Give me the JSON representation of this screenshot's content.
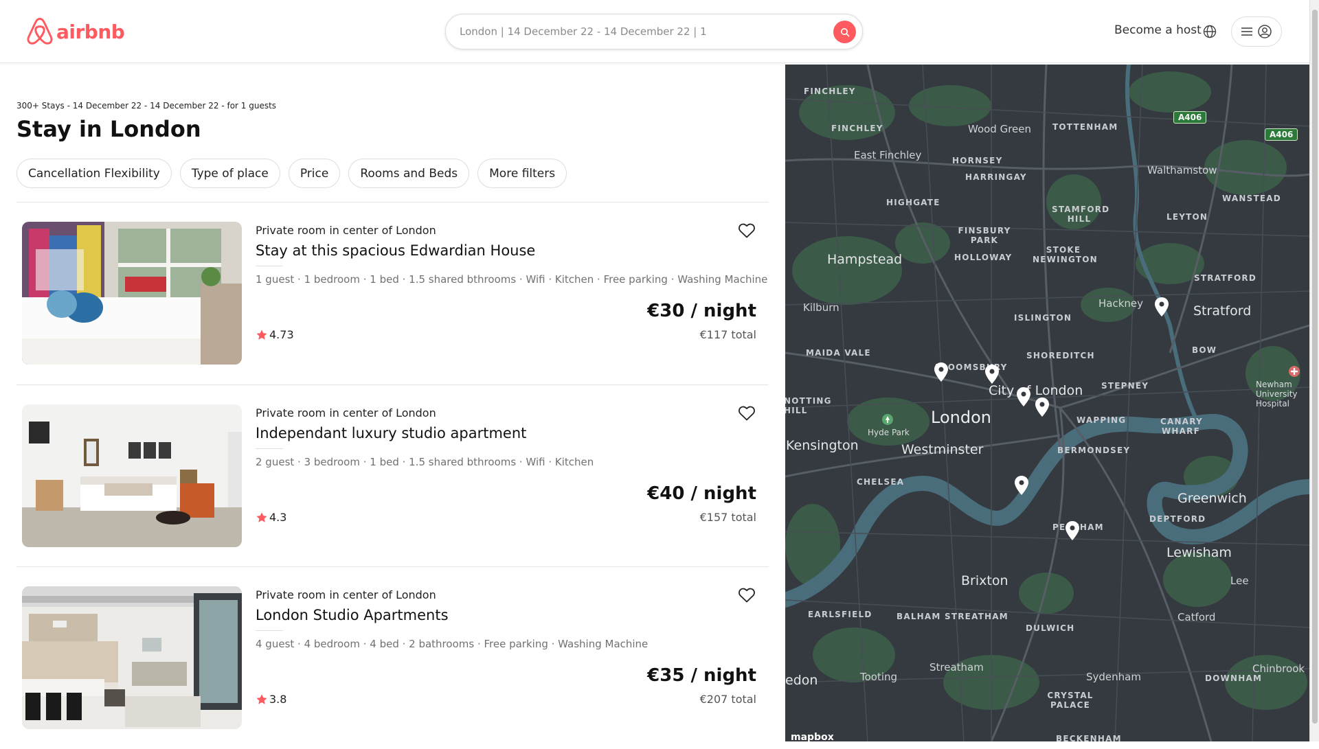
{
  "brand": {
    "name": "airbnb",
    "color": "#ff5a5f"
  },
  "search": {
    "value": "London | 14 December 22 - 14 December 22 | 1"
  },
  "nav": {
    "become_host": "Become a host"
  },
  "results": {
    "subtitle": "300+ Stays - 14 December 22 - 14 December 22 - for 1 guests",
    "title": "Stay in London"
  },
  "filters": [
    "Cancellation Flexibility",
    "Type of place",
    "Price",
    "Rooms and Beds",
    "More filters"
  ],
  "listings": [
    {
      "type": "Private room in center of London",
      "name": "Stay at this spacious Edwardian House",
      "amenities": "1 guest · 1 bedroom · 1 bed · 1.5 shared bthrooms · Wifi · Kitchen · Free parking · Washing Machine",
      "price": "€30 / night",
      "total": "€117 total",
      "rating": "4.73"
    },
    {
      "type": "Private room in center of London",
      "name": "Independant luxury studio apartment",
      "amenities": "2 guest · 3 bedroom · 1 bed · 1.5 shared bthrooms · Wifi · Kitchen",
      "price": "€40 / night",
      "total": "€157 total",
      "rating": "4.3"
    },
    {
      "type": "Private room in center of London",
      "name": "London Studio Apartments",
      "amenities": "4 guest · 4 bedroom · 4 bed · 2 bathrooms · Free parking · Washing Machine",
      "price": "€35 / night",
      "total": "€207 total",
      "rating": "3.8"
    }
  ],
  "map": {
    "roads": [
      "A406",
      "A406"
    ],
    "labels": [
      "FINCHLEY",
      "FINCHLEY",
      "Wood Green",
      "TOTTENHAM",
      "East Finchley",
      "HORNSEY",
      "HARRINGAY",
      "Walthamstow",
      "WANSTEAD",
      "HIGHGATE",
      "STAMFORD HILL",
      "LEYTON",
      "FINSBURY PARK",
      "Hampstead",
      "HOLLOWAY",
      "STOKE NEWINGTON",
      "STRATFORD",
      "Kilburn",
      "Hackney",
      "Stratford",
      "ISLINGTON",
      "MAIDA VALE",
      "BOW",
      "SHOREDITCH",
      "BLOOMSBURY",
      "Newham University Hospital",
      "City of London",
      "STEPNEY",
      "NOTTING HILL",
      "Hyde Park",
      "London",
      "WAPPING",
      "CANARY WHARF",
      "Kensington",
      "Westminster",
      "BERMONDSEY",
      "CHELSEA",
      "Greenwich",
      "PECKHAM",
      "DEPTFORD",
      "Lewisham",
      "Lee",
      "Brixton",
      "EARLSFIELD",
      "BALHAM",
      "STREATHAM",
      "DULWICH",
      "Catford",
      "Streatham",
      "Tooting",
      "Sydenham",
      "Chinbrook",
      "edon",
      "DOWNHAM",
      "CRYSTAL PALACE",
      "BECKENHAM",
      "mapbox"
    ],
    "water_color": "#4a6d7c",
    "park_color": "#3b5a48",
    "land_color": "#343a40"
  }
}
